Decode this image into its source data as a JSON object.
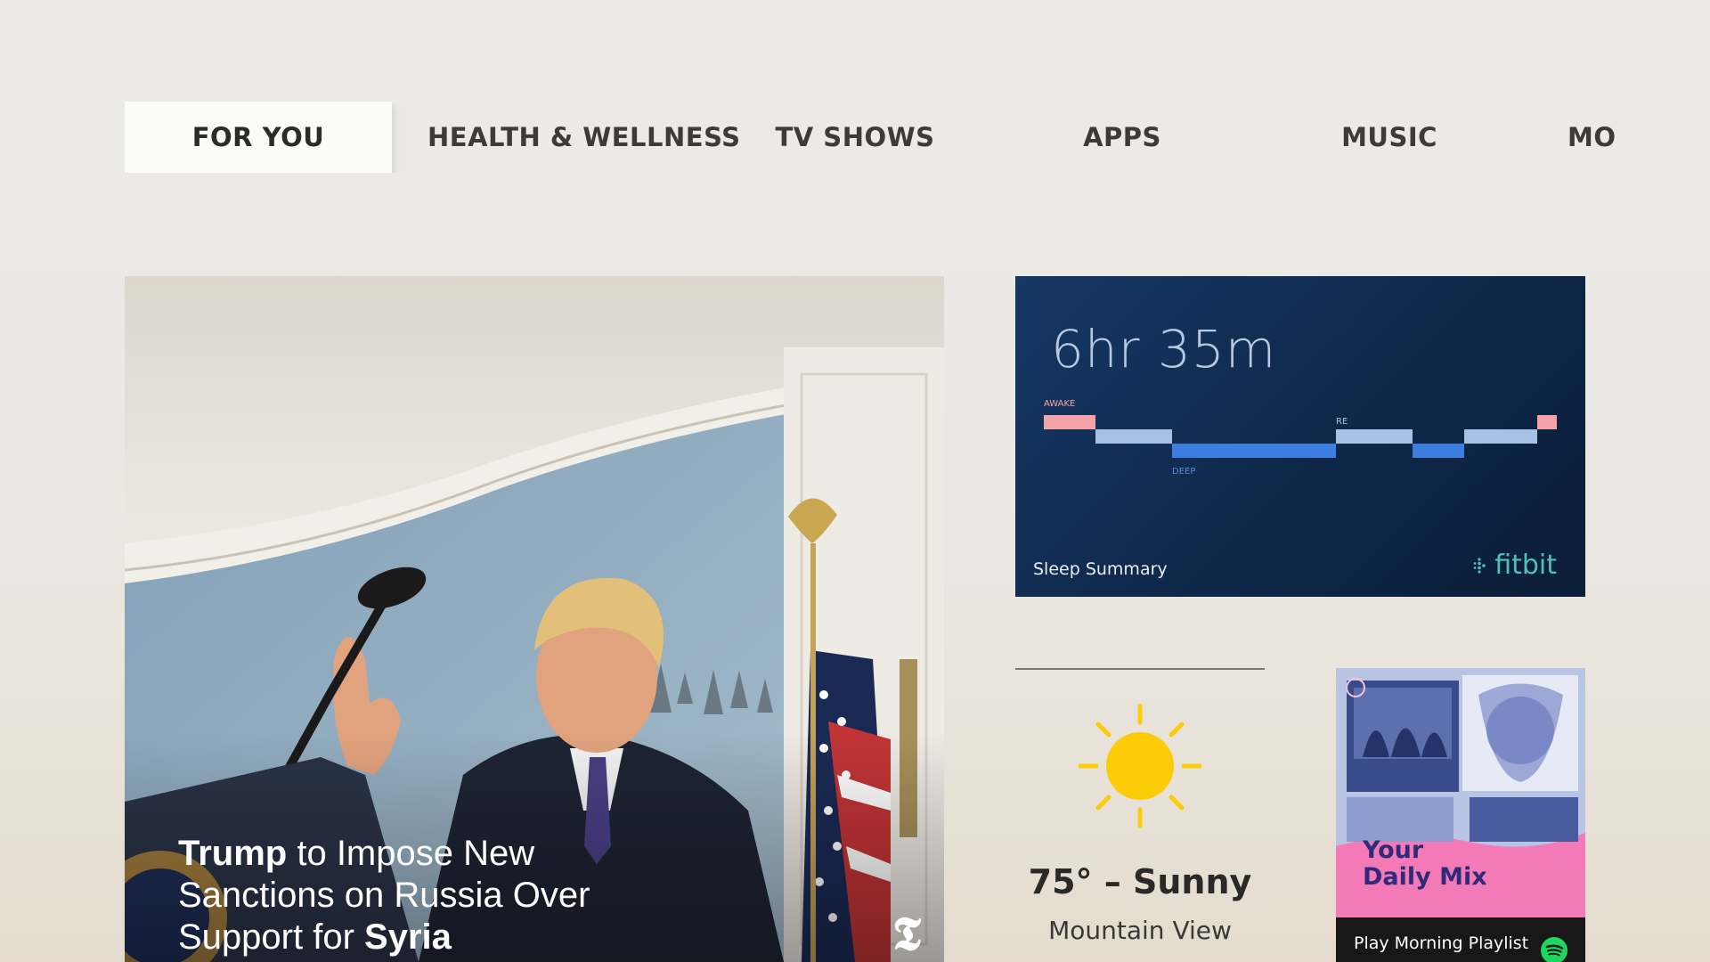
{
  "tabs": [
    {
      "label": "FOR YOU",
      "selected": true
    },
    {
      "label": "HEALTH & WELLNESS",
      "selected": false
    },
    {
      "label": "TV SHOWS",
      "selected": false
    },
    {
      "label": "APPS",
      "selected": false
    },
    {
      "label": "MUSIC",
      "selected": false
    },
    {
      "label": "MO",
      "selected": false
    }
  ],
  "news": {
    "headline_pre": "Trump",
    "headline_mid": " to Impose New Sanctions on Russia Over Support for ",
    "headline_post": "Syria",
    "source_icon": "nyt-logo-icon"
  },
  "fitbit": {
    "total": "6hr 35m",
    "label_awake": "AWAKE",
    "label_rem": "RE",
    "label_deep": "DEEP",
    "caption": "Sleep Summary",
    "brand": "fitbit",
    "stages": [
      "awake",
      "light",
      "deep",
      "deep",
      "rem",
      "deep",
      "light",
      "awake"
    ],
    "colors": {
      "awake": "#f4a4a8",
      "light": "#a9c0e6",
      "deep": "#3d7fe0",
      "rem": "#a9c0e6"
    }
  },
  "weather": {
    "icon": "sun-icon",
    "temp": "75° – Sunny",
    "city": "Mountain View"
  },
  "spotify": {
    "title_line1": "Your",
    "title_line2": "Daily Mix",
    "footer": "Play Morning Playlist",
    "icon": "spotify-icon",
    "accent": "#f47ab7"
  }
}
